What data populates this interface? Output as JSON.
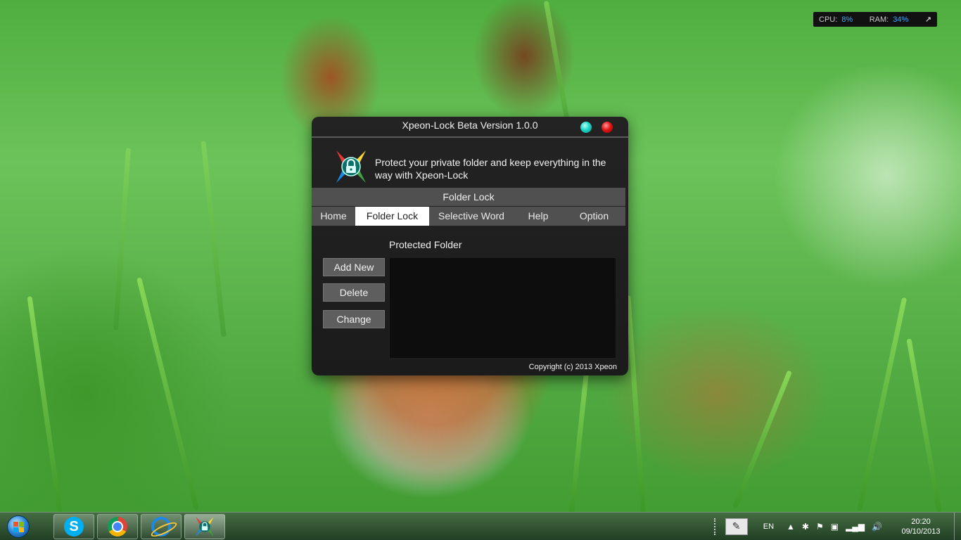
{
  "system_widget": {
    "cpu_label": "CPU:",
    "cpu_value": "8%",
    "ram_label": "RAM:",
    "ram_value": "34%",
    "expand_icon": "expand-arrow-icon"
  },
  "app": {
    "title": "Xpeon-Lock Beta Version 1.0.0",
    "tagline": "Protect your private folder and keep everything in the way with Xpeon-Lock",
    "section_title": "Folder Lock",
    "tabs": [
      {
        "label": "Home",
        "active": false
      },
      {
        "label": "Folder Lock",
        "active": true
      },
      {
        "label": "Selective Word",
        "active": false
      },
      {
        "label": "Help",
        "active": false
      },
      {
        "label": "Option",
        "active": false
      }
    ],
    "protected_folder_label": "Protected Folder",
    "buttons": {
      "add_new": "Add New",
      "delete": "Delete",
      "change": "Change"
    },
    "copyright": "Copyright (c) 2013 Xpeon",
    "colors": {
      "minimize": "#1ed6c8",
      "close": "#e51515",
      "tab_bar": "#505050",
      "active_tab": "#ffffff"
    }
  },
  "taskbar": {
    "items": [
      "skype-icon",
      "chrome-icon",
      "internet-explorer-icon",
      "xpeon-lock-icon"
    ],
    "tray": {
      "language": "EN",
      "time": "20:20",
      "date": "09/10/2013"
    }
  }
}
